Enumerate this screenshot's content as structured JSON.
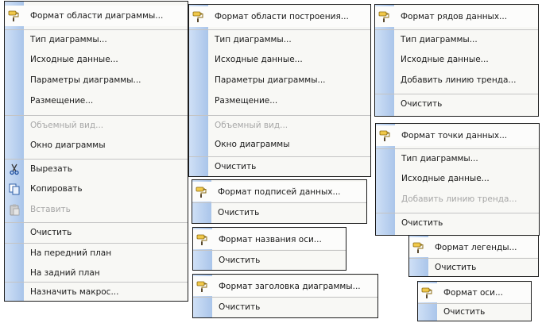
{
  "menus": {
    "chart_area": {
      "items": [
        {
          "label": "Формат области диаграммы..."
        },
        {
          "label": "Тип диаграммы..."
        },
        {
          "label": "Исходные данные..."
        },
        {
          "label": "Параметры диаграммы..."
        },
        {
          "label": "Размещение..."
        },
        {
          "label": "Объемный вид..."
        },
        {
          "label": "Окно диаграммы"
        },
        {
          "label": "Вырезать"
        },
        {
          "label": "Копировать"
        },
        {
          "label": "Вставить"
        },
        {
          "label": "Очистить"
        },
        {
          "label": "На передний план"
        },
        {
          "label": "На задний план"
        },
        {
          "label": "Назначить макрос..."
        }
      ]
    },
    "plot_area": {
      "items": [
        {
          "label": "Формат области построения..."
        },
        {
          "label": "Тип диаграммы..."
        },
        {
          "label": "Исходные данные..."
        },
        {
          "label": "Параметры диаграммы..."
        },
        {
          "label": "Размещение..."
        },
        {
          "label": "Объемный вид..."
        },
        {
          "label": "Окно диаграммы"
        },
        {
          "label": "Очистить"
        }
      ]
    },
    "data_series": {
      "items": [
        {
          "label": "Формат рядов данных..."
        },
        {
          "label": "Тип диаграммы..."
        },
        {
          "label": "Исходные данные..."
        },
        {
          "label": "Добавить линию тренда..."
        },
        {
          "label": "Очистить"
        }
      ]
    },
    "data_point": {
      "items": [
        {
          "label": "Формат точки данных..."
        },
        {
          "label": "Тип диаграммы..."
        },
        {
          "label": "Исходные данные..."
        },
        {
          "label": "Добавить линию тренда..."
        },
        {
          "label": "Очистить"
        }
      ]
    },
    "data_labels": {
      "items": [
        {
          "label": "Формат подписей данных..."
        },
        {
          "label": "Очистить"
        }
      ]
    },
    "axis_title": {
      "items": [
        {
          "label": "Формат названия оси..."
        },
        {
          "label": "Очистить"
        }
      ]
    },
    "chart_title": {
      "items": [
        {
          "label": "Формат заголовка диаграммы..."
        },
        {
          "label": "Очистить"
        }
      ]
    },
    "legend": {
      "items": [
        {
          "label": "Формат легенды..."
        },
        {
          "label": "Очистить"
        }
      ]
    },
    "axis": {
      "items": [
        {
          "label": "Формат оси..."
        },
        {
          "label": "Очистить"
        }
      ]
    }
  }
}
